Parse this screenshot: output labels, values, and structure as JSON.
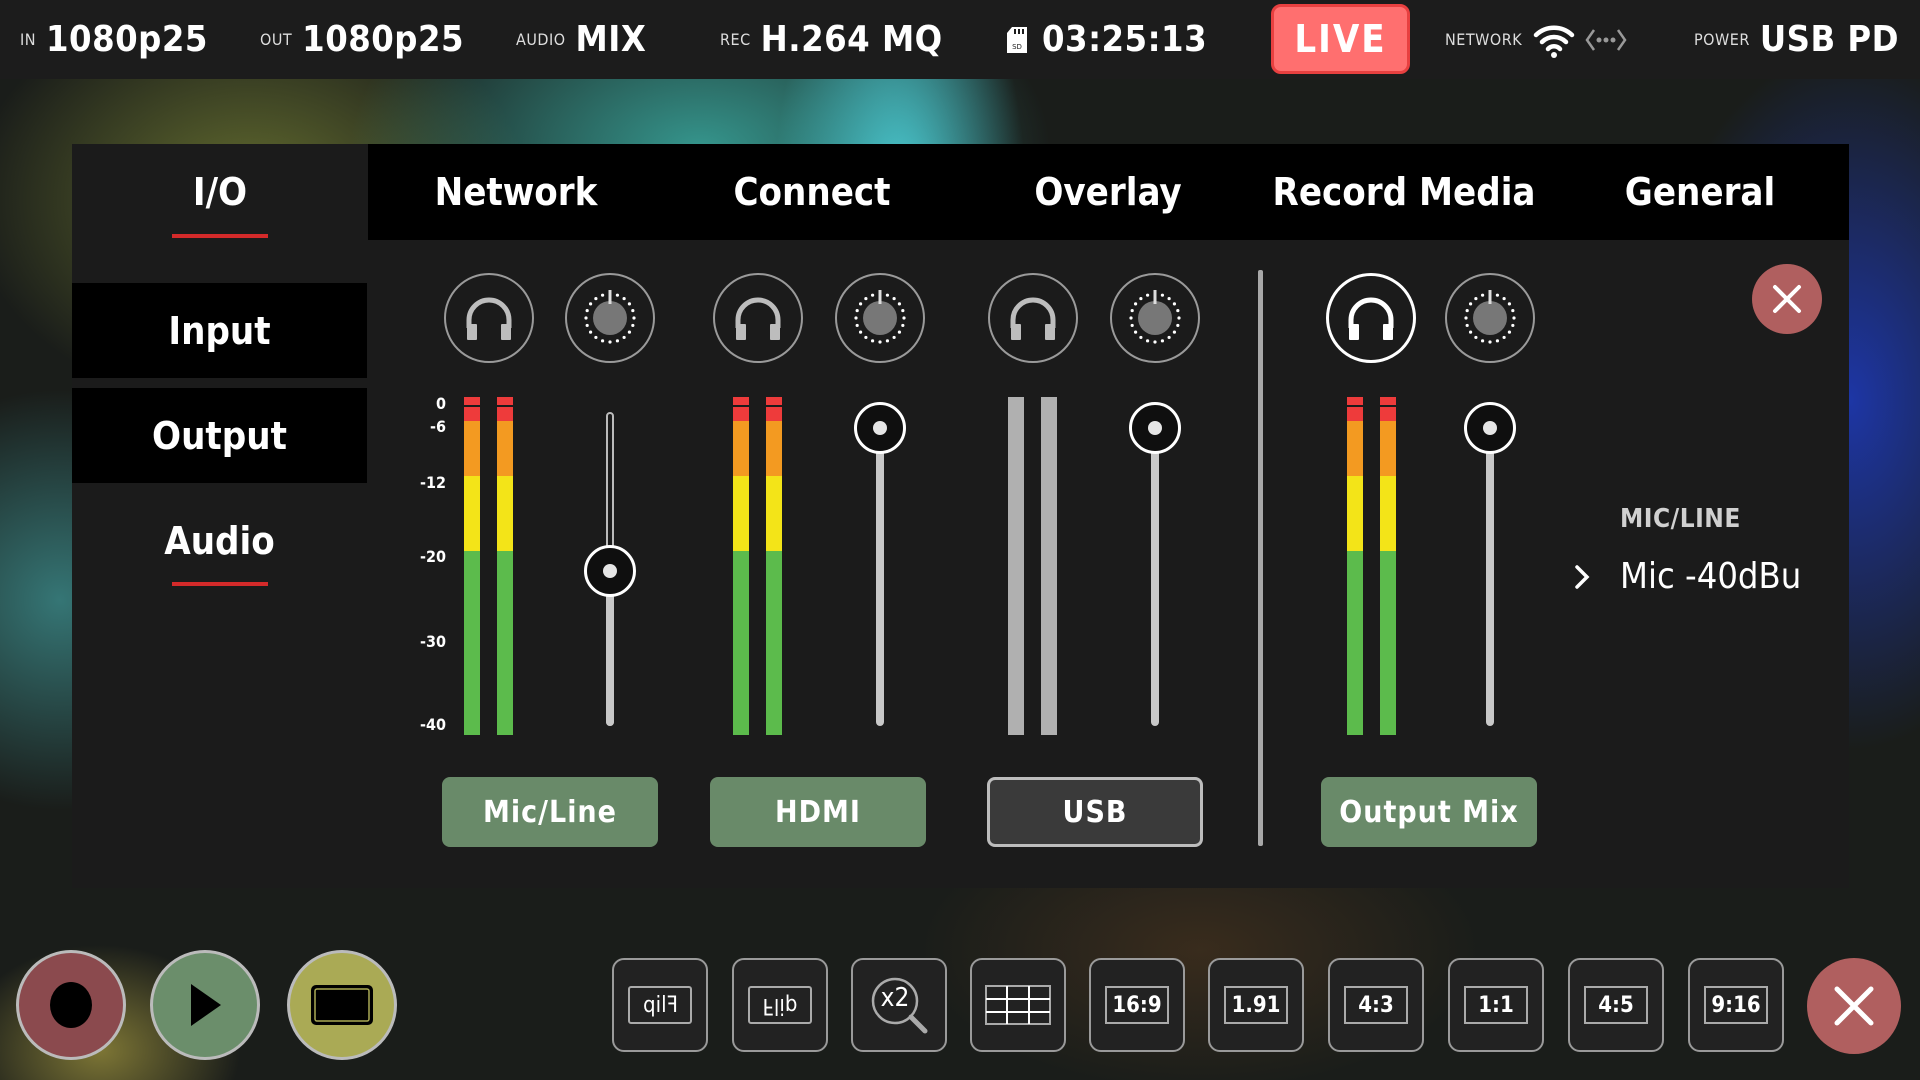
{
  "status_bar": {
    "input": {
      "label": "IN",
      "value": "1080p25"
    },
    "output": {
      "label": "OUT",
      "value": "1080p25"
    },
    "audio": {
      "label": "AUDIO",
      "value": "MIX"
    },
    "rec": {
      "label": "REC",
      "value": "H.264 MQ"
    },
    "media": {
      "icon": "sd-card-icon",
      "value": "03:25:13"
    },
    "live_badge": "LIVE",
    "network": {
      "label": "NETWORK",
      "icons": [
        "wifi-icon",
        "ethernet-icon"
      ]
    },
    "power": {
      "label": "POWER",
      "value": "USB PD"
    },
    "colors": {
      "live_bg": "#ff6f6f",
      "live_border": "#e84040"
    }
  },
  "settings": {
    "tabs": [
      {
        "label": "I/O",
        "active": true
      },
      {
        "label": "Network",
        "active": false
      },
      {
        "label": "Connect",
        "active": false
      },
      {
        "label": "Overlay",
        "active": false
      },
      {
        "label": "Record Media",
        "active": false
      },
      {
        "label": "General",
        "active": false
      }
    ],
    "sidebar": [
      {
        "label": "Input",
        "active": false
      },
      {
        "label": "Output",
        "active": false
      },
      {
        "label": "Audio",
        "active": true
      }
    ],
    "accent_color": "#d42a2a"
  },
  "mixer": {
    "scale_labels": [
      "0",
      "-6",
      "-12",
      "-20",
      "-30",
      "-40"
    ],
    "channels": [
      {
        "name": "Mic/Line",
        "selected": false,
        "meter_active": true,
        "monitor_on": false,
        "fader_level": 0.52
      },
      {
        "name": "HDMI",
        "selected": false,
        "meter_active": true,
        "monitor_on": false,
        "fader_level": 1.0
      },
      {
        "name": "USB",
        "selected": true,
        "meter_active": false,
        "monitor_on": false,
        "fader_level": 1.0
      },
      {
        "name": "Output Mix",
        "selected": false,
        "meter_active": true,
        "monitor_on": true,
        "fader_level": 1.0
      }
    ],
    "meter_colors": {
      "red": "#ee3b3b",
      "orange": "#f39a21",
      "yellow": "#f3e418",
      "green": "#5cbb4c",
      "inactive": "#b0b0b0"
    },
    "button_color": "#698a69"
  },
  "detail": {
    "heading": "MIC/LINE",
    "value": "Mic -40dBu"
  },
  "bottom_bar": {
    "transport": [
      {
        "name": "record",
        "color": "#8b4a4e"
      },
      {
        "name": "play",
        "color": "#6b8e6b"
      },
      {
        "name": "stop",
        "color": "#aaaa55"
      }
    ],
    "tools": [
      {
        "name": "flip-horizontal",
        "label": "Flip"
      },
      {
        "name": "flip-vertical",
        "label": "Flip"
      },
      {
        "name": "zoom",
        "label": "x2"
      },
      {
        "name": "grid",
        "label": ""
      },
      {
        "name": "aspect-16-9",
        "label": "16:9"
      },
      {
        "name": "aspect-1-91",
        "label": "1.91"
      },
      {
        "name": "aspect-4-3",
        "label": "4:3"
      },
      {
        "name": "aspect-1-1",
        "label": "1:1"
      },
      {
        "name": "aspect-4-5",
        "label": "4:5"
      },
      {
        "name": "aspect-9-16",
        "label": "9:16"
      }
    ]
  }
}
